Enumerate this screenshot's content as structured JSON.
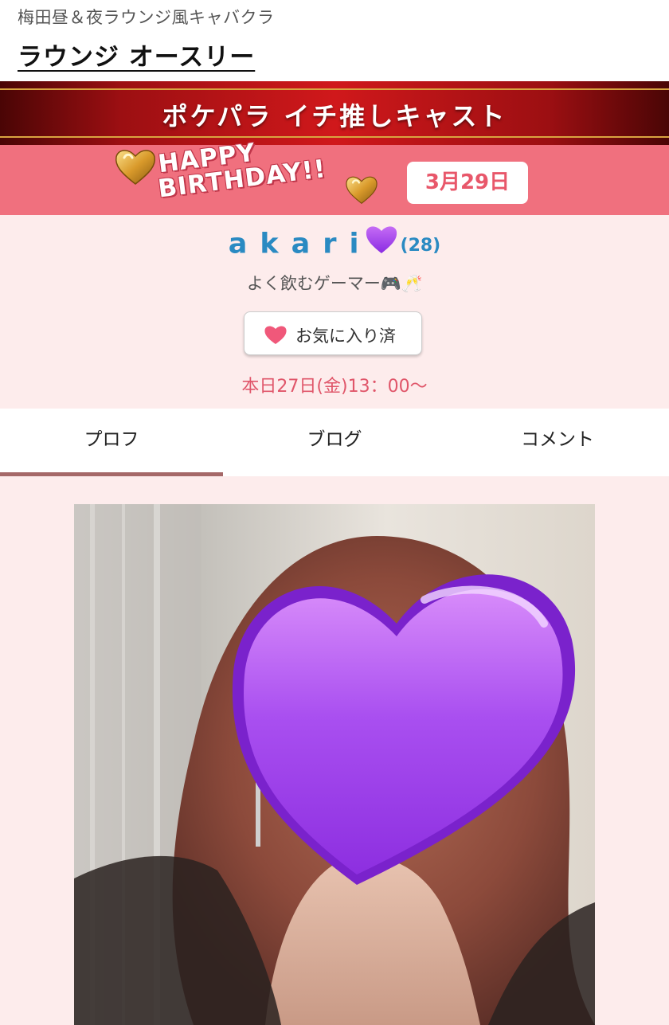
{
  "shop": {
    "category": "梅田昼＆夜ラウンジ風キャバクラ",
    "name": "ラウンジ オースリー"
  },
  "banner": {
    "pickup_label": "ポケパラ イチ推しキャスト"
  },
  "birthday": {
    "line1": "HAPPY",
    "line2": "BIRTHDAY!!",
    "date": "3月29日"
  },
  "cast": {
    "name": "akari",
    "age": "(28)",
    "catchphrase": "よく飲むゲーマー🎮🥂",
    "favorite_label": "お気に入り済",
    "schedule": "本日27日(金)13：00〜"
  },
  "tabs": [
    {
      "label": "プロフ",
      "active": true
    },
    {
      "label": "ブログ",
      "active": false
    },
    {
      "label": "コメント",
      "active": false
    }
  ],
  "colors": {
    "birthday_bar": "#f0707e",
    "cast_name": "#2a8ac2",
    "schedule": "#e0566a",
    "profile_bg": "#fdecec",
    "tab_active_underline": "#a56868"
  }
}
